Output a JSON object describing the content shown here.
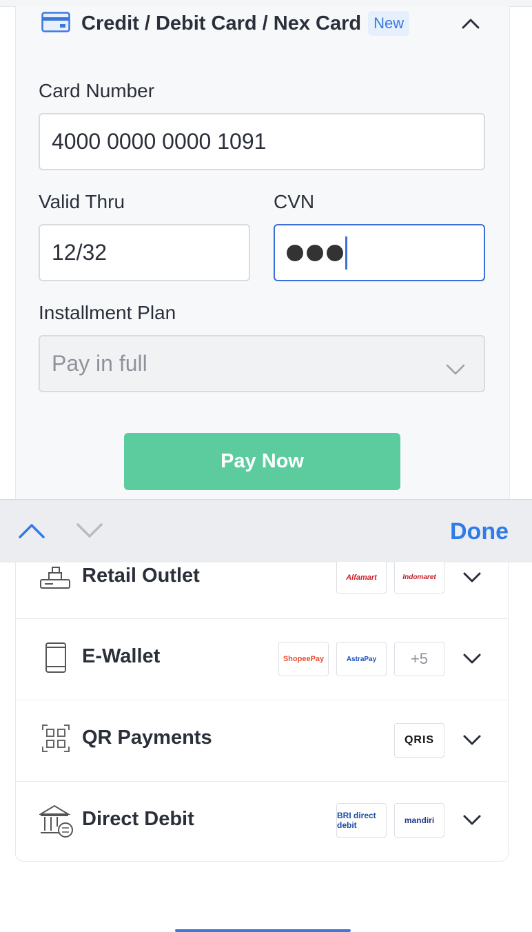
{
  "card_section": {
    "title": "Credit / Debit Card / Nex Card",
    "badge": "New",
    "card_number_label": "Card Number",
    "card_number_value": "4000 0000 0000 1091",
    "valid_thru_label": "Valid Thru",
    "valid_thru_value": "12/32",
    "cvn_label": "CVN",
    "installment_label": "Installment Plan",
    "installment_value": "Pay in full",
    "pay_button": "Pay Now"
  },
  "keyboard_toolbar": {
    "done_label": "Done"
  },
  "methods": [
    {
      "name": "Retail Outlet",
      "icon": "cash-register-icon",
      "logos": [
        "Alfamart",
        "Indomaret"
      ]
    },
    {
      "name": "E-Wallet",
      "icon": "phone-icon",
      "logos": [
        "ShopeePay",
        "AstraPay"
      ],
      "more": "+5"
    },
    {
      "name": "QR Payments",
      "icon": "qr-icon",
      "logos": [
        "QRIS"
      ]
    },
    {
      "name": "Direct Debit",
      "icon": "bank-icon",
      "logos": [
        "BRI direct debit",
        "mandiri"
      ]
    }
  ],
  "colors": {
    "accent": "#2f7be8",
    "pay_button": "#5ccc9e",
    "focus": "#3a6fd9"
  }
}
